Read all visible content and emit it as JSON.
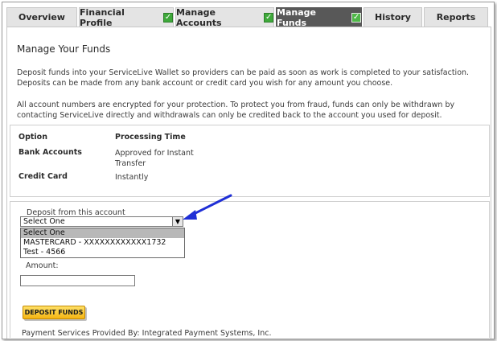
{
  "tabs": [
    {
      "label": "Overview",
      "checked": false
    },
    {
      "label": "Financial Profile",
      "checked": true
    },
    {
      "label": "Manage Accounts",
      "checked": true
    },
    {
      "label": "Manage Funds",
      "checked": true,
      "active": true
    },
    {
      "label": "History",
      "checked": false
    },
    {
      "label": "Reports",
      "checked": false
    }
  ],
  "page": {
    "title": "Manage Your Funds",
    "intro": "Deposit funds into your ServiceLive Wallet so providers can be paid as soon as work is completed to your satisfaction. Deposits can be made from any bank account or credit card you wish for any amount you choose.",
    "security": "All account numbers are encrypted for your protection. To protect you from fraud, funds can only be withdrawn by contacting ServiceLive directly and withdrawals can only be credited back to the account you used for deposit."
  },
  "options_table": {
    "headers": {
      "option": "Option",
      "processing": "Processing Time"
    },
    "rows": [
      {
        "option": "Bank Accounts",
        "processing": "Approved for Instant Transfer"
      },
      {
        "option": "Credit Card",
        "processing": "Instantly"
      }
    ]
  },
  "deposit_form": {
    "account_label": "Deposit from this account",
    "selected": "Select One",
    "options": [
      "Select One",
      "MASTERCARD - XXXXXXXXXXXX1732",
      "Test - 4566"
    ],
    "amount_label": "Amount:",
    "amount_value": "",
    "submit_label": "DEPOSIT FUNDS"
  },
  "footer": "Payment Services Provided By: Integrated Payment Systems, Inc.",
  "colors": {
    "active_tab": "#585858",
    "check": "#3ea93a",
    "arrow": "#1f2fd6",
    "button": "#f5b512"
  }
}
